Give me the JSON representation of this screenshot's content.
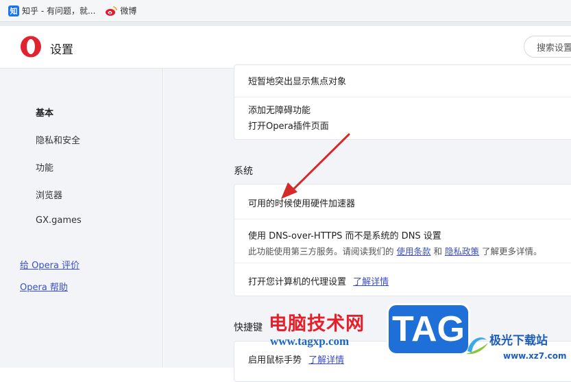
{
  "bookmarks": {
    "zhihu_icon": "知",
    "zhihu_label": "知乎 - 有问题，就...",
    "weibo_label": "微博"
  },
  "header": {
    "title": "设置",
    "search_placeholder": "搜索设置"
  },
  "sidebar": {
    "items": [
      {
        "label": "基本",
        "active": true
      },
      {
        "label": "隐私和安全"
      },
      {
        "label": "功能"
      },
      {
        "label": "浏览器"
      },
      {
        "label": "GX.games"
      }
    ],
    "links": [
      "给 Opera 评价",
      "Opera 帮助"
    ]
  },
  "main": {
    "top_card": {
      "row1": "短暂地突出显示焦点对象",
      "row2_line1": "添加无障碍功能",
      "row2_line2": "打开Opera插件页面"
    },
    "system": {
      "title": "系统",
      "hw_accel": "可用的时候使用硬件加速器",
      "dns_title": "使用 DNS-over-HTTPS 而不是系统的 DNS 设置",
      "dns_desc_prefix": "此功能使用第三方服务。请阅读我们的",
      "dns_terms": "使用条款",
      "dns_and": "和",
      "dns_privacy": "隐私政策",
      "dns_suffix": "了解更多详情。",
      "proxy": "打开您计算机的代理设置",
      "proxy_link": "了解详情"
    },
    "shortcuts": {
      "title": "快捷键",
      "mouse_gestures": "启用鼠标手势",
      "mouse_link": "了解详情"
    }
  },
  "watermark": {
    "cn": "电脑技术网",
    "url": "www.tagxp.com",
    "tag": "TAG",
    "jg": "极光下载站",
    "jg_url": "www.xz7.com"
  },
  "colors": {
    "accent": "#3a4ec8",
    "opera_red": "#e0232e",
    "arrow": "#d42a2a"
  }
}
